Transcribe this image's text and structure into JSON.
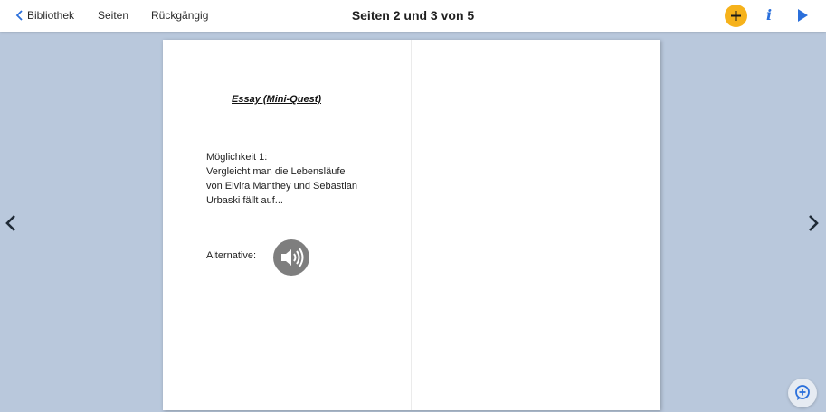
{
  "header": {
    "back_label": "Bibliothek",
    "pages_label": "Seiten",
    "undo_label": "Rückgängig",
    "title": "Seiten 2 und 3 von 5",
    "info_glyph": "i",
    "icons": {
      "back": "chevron-left-icon",
      "add": "plus-icon",
      "info": "info-icon",
      "play": "play-icon"
    },
    "colors": {
      "add_button": "#f6b21b",
      "accent": "#2a6fdb"
    }
  },
  "page_left": {
    "heading": "Essay (Mini-Quest)",
    "option_lines": [
      "Möglichkeit 1:",
      "Vergleicht man die Lebensläufe",
      "von Elvira Manthey und Sebastian",
      "Urbaski fällt auf..."
    ],
    "alternative_label": "Alternative:",
    "audio_icon": "speaker-icon"
  },
  "navigation": {
    "prev_icon": "chevron-left-icon",
    "next_icon": "chevron-right-icon"
  },
  "chat_icon": "chat-add-icon",
  "background_color": "#b9c8dc"
}
